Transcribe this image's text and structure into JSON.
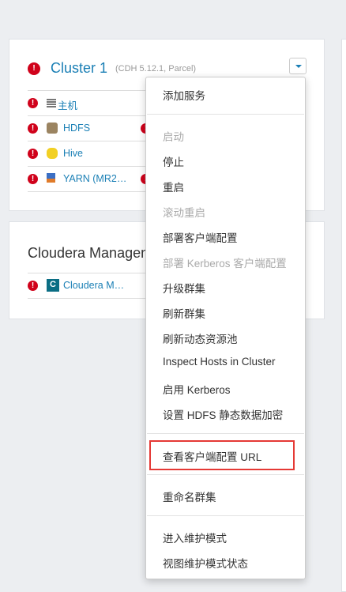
{
  "cluster": {
    "name": "Cluster 1",
    "subtitle": "(CDH 5.12.1, Parcel)",
    "services": [
      {
        "label": "主机",
        "icon": "hosts-icon"
      },
      {
        "label": "HDFS",
        "icon": "hdfs-icon"
      },
      {
        "label": "Hive",
        "icon": "hive-icon"
      },
      {
        "label": "YARN (MR2…",
        "icon": "yarn-icon"
      }
    ]
  },
  "cm": {
    "title": "Cloudera Managem",
    "service": "Cloudera M…"
  },
  "menu": {
    "items": [
      "添加服务",
      "启动",
      "停止",
      "重启",
      "滚动重启",
      "部署客户端配置",
      "部署 Kerberos 客户端配置",
      "升级群集",
      "刷新群集",
      "刷新动态资源池",
      "Inspect Hosts in Cluster",
      "启用 Kerberos",
      "设置 HDFS 静态数据加密",
      "查看客户端配置 URL",
      "重命名群集",
      "进入维护模式",
      "视图维护模式状态"
    ]
  },
  "colors": {
    "accent": "#1a7fb5",
    "error": "#d0021b",
    "highlight": "#e53935"
  }
}
